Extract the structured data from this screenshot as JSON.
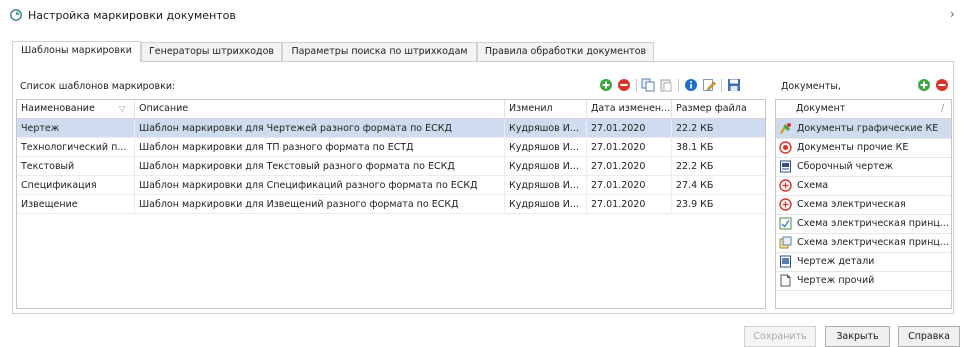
{
  "window": {
    "title": "Настройка маркировки документов",
    "close_glyph": "›"
  },
  "tabs": [
    {
      "label": "Шаблоны маркировки",
      "active": true
    },
    {
      "label": "Генераторы штрихкодов",
      "active": false
    },
    {
      "label": "Параметры поиска по штрихкодам",
      "active": false
    },
    {
      "label": "Правила обработки документов",
      "active": false
    }
  ],
  "templates": {
    "section_label": "Список шаблонов маркировки:",
    "toolbar_icons": [
      "add-icon",
      "remove-icon",
      "copy-icon",
      "paste-icon",
      "info-icon",
      "edit-icon",
      "save-icon"
    ],
    "columns": [
      "Наименование",
      "Описание",
      "Изменил",
      "Дата изменен...",
      "Размер файла"
    ],
    "sort_glyph": "▽",
    "rows": [
      {
        "name": "Чертеж",
        "description": "Шаблон маркировки для Чертежей разного формата по ЕСКД",
        "changed_by": "Кудряшов И...",
        "date": "27.01.2020",
        "size": "22.2 КБ",
        "selected": true
      },
      {
        "name": "Технологический п...",
        "description": "Шаблон маркировки для ТП разного формата по ЕСТД",
        "changed_by": "Кудряшов И...",
        "date": "27.01.2020",
        "size": "38.1 КБ",
        "selected": false
      },
      {
        "name": "Текстовый",
        "description": "Шаблон маркировки для Текстовый разного формата по ЕСКД",
        "changed_by": "Кудряшов И...",
        "date": "27.01.2020",
        "size": "22.2 КБ",
        "selected": false
      },
      {
        "name": "Спецификация",
        "description": "Шаблон маркировки для Спецификаций разного формата по ЕСКД",
        "changed_by": "Кудряшов И...",
        "date": "27.01.2020",
        "size": "27.4 КБ",
        "selected": false
      },
      {
        "name": "Извещение",
        "description": "Шаблон маркировки для Извещений разного формата по ЕСКД",
        "changed_by": "Кудряшов И...",
        "date": "27.01.2020",
        "size": "23.9 КБ",
        "selected": false
      }
    ]
  },
  "documents": {
    "section_label": "Документы,",
    "column": "Документ",
    "header_glyph": "/",
    "items": [
      {
        "label": "Документы графические КЕ",
        "icon": "graphic-docs-icon",
        "selected": true
      },
      {
        "label": "Документы прочие КЕ",
        "icon": "other-docs-icon",
        "selected": false
      },
      {
        "label": "Сборочный чертеж",
        "icon": "assembly-drawing-icon",
        "selected": false
      },
      {
        "label": "Схема",
        "icon": "scheme-icon",
        "selected": false
      },
      {
        "label": "Схема электрическая",
        "icon": "electric-scheme-icon",
        "selected": false
      },
      {
        "label": "Схема электрическая принц...",
        "icon": "electric-principal-scheme-icon",
        "selected": false
      },
      {
        "label": "Схема электрическая принц...",
        "icon": "electric-principal-scheme-alt-icon",
        "selected": false
      },
      {
        "label": "Чертеж детали",
        "icon": "part-drawing-icon",
        "selected": false
      },
      {
        "label": "Чертеж прочий",
        "icon": "other-drawing-icon",
        "selected": false
      }
    ]
  },
  "buttons": {
    "save": "Сохранить",
    "close": "Закрыть",
    "help": "Справка"
  },
  "colors": {
    "add_green": "#3aa640",
    "remove_red": "#d9342b",
    "info_blue": "#1e6fc7",
    "selection": "#cfdcf0"
  }
}
